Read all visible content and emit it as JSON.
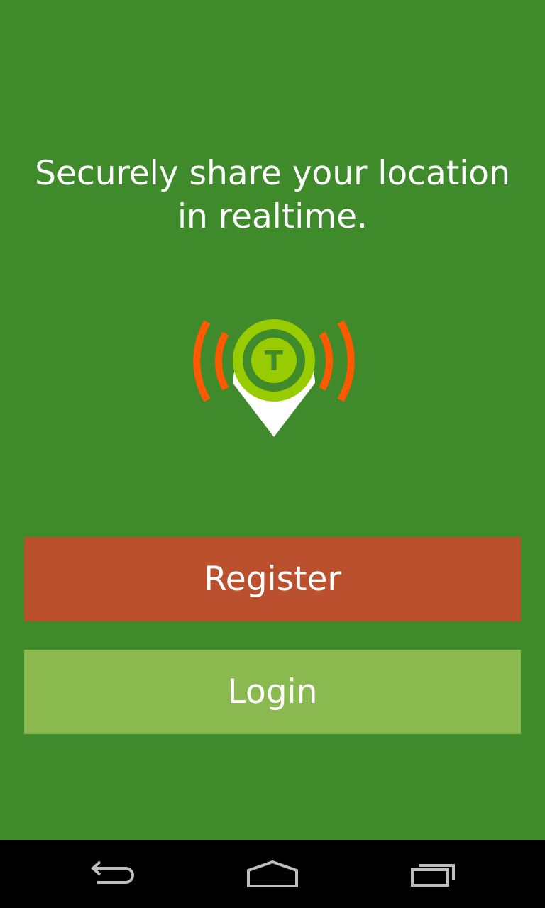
{
  "tagline": {
    "line1": "Securely share your location",
    "line2": "in realtime."
  },
  "logo": {
    "letter": "T",
    "icon": "location-pin-broadcast-icon"
  },
  "buttons": {
    "register_label": "Register",
    "login_label": "Login"
  },
  "navbar": {
    "back_icon": "back-icon",
    "home_icon": "home-icon",
    "recents_icon": "recent-apps-icon"
  },
  "colors": {
    "background": "#3f8a2b",
    "register_button": "#bb502f",
    "login_button": "#8aba4f",
    "logo_ring": "#99cc00",
    "logo_waves": "#ff5a00",
    "navbar": "#000000"
  }
}
